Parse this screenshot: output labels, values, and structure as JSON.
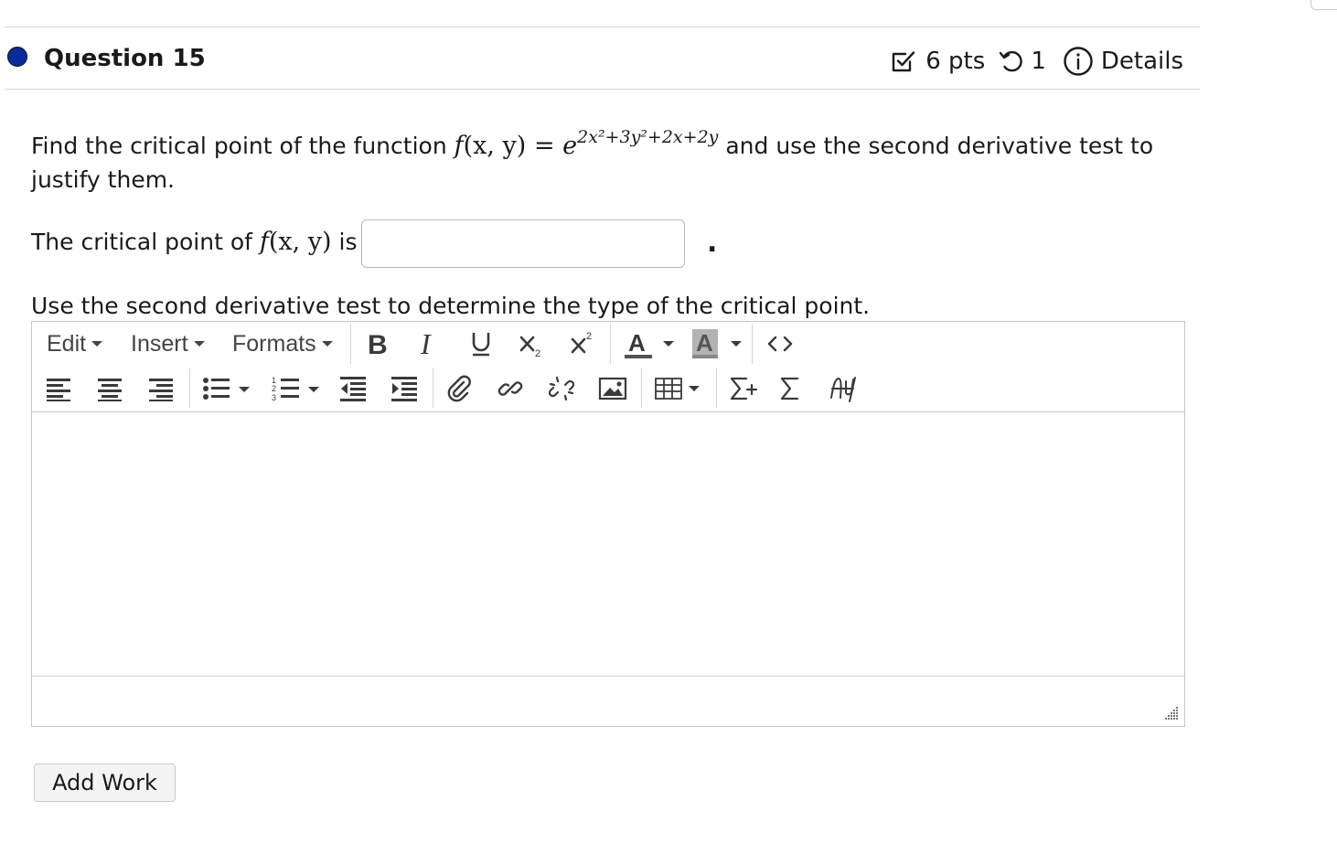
{
  "question": {
    "title": "Question 15",
    "points": "6 pts",
    "attempts": "1",
    "details_label": "Details"
  },
  "prompt": {
    "line1_before": "Find the critical point of the function",
    "func_name": "f",
    "func_args": "(x, y)",
    "equals": "=",
    "base": "e",
    "exponent": "2x²+3y²+2x+2y",
    "line1_after": "and use the second derivative test to",
    "line2": "justify them."
  },
  "answer": {
    "label_before": "The critical point of",
    "func": "f",
    "args": "(x, y)",
    "label_after": "is",
    "value": "",
    "placeholder": "",
    "trailing": "."
  },
  "instruction": "Use the second derivative test to determine the type of the critical point.",
  "editor": {
    "menus": [
      "Edit",
      "Insert",
      "Formats"
    ],
    "content": ""
  },
  "icons": {
    "points": "checkbox-pencil-icon",
    "attempts": "retry-icon",
    "details": "info-icon"
  },
  "buttons": {
    "add_work": "Add Work"
  },
  "colors": {
    "question_dot": "#0b2a9c"
  }
}
